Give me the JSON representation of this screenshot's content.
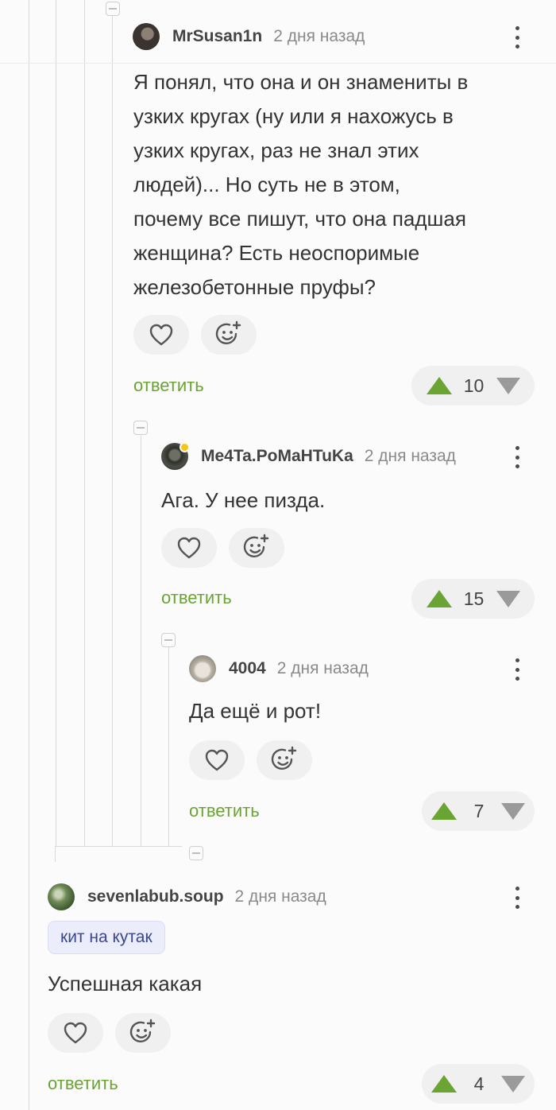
{
  "colors": {
    "accent_green": "#6aa432",
    "vote_down_gray": "#9a9a9a",
    "tag_bg": "#ecedfb",
    "tag_text": "#3b4690",
    "muted_text": "#8a8a8a"
  },
  "comments": [
    {
      "username": "MrSusan1n",
      "time": "2 дня назад",
      "lines": [
        "Я понял, что она и он знамениты в",
        "узких кругах (ну или я нахожусь в",
        "узких кругах, раз не знал этих",
        "людей)... Но суть не в этом,",
        "почему все пишут, что она падшая",
        "женщина? Есть неоспоримые",
        "железобетонные пруфы?"
      ],
      "reply_label": "ответить",
      "score": "10"
    },
    {
      "username": "Me4Ta.PoMaHTuKa",
      "time": "2 дня назад",
      "text": "Ага. У нее пизда.",
      "reply_label": "ответить",
      "score": "15"
    },
    {
      "username": "4004",
      "time": "2 дня назад",
      "text": "Да ещё и рот!",
      "reply_label": "ответить",
      "score": "7"
    },
    {
      "username": "sevenlabub.soup",
      "time": "2 дня назад",
      "tag": "кит на кутак",
      "text": "Успешная какая",
      "reply_label": "ответить",
      "score": "4"
    }
  ],
  "icons": {
    "like": "heart-icon",
    "react": "add-emoji-icon",
    "upvote": "upvote-arrow-icon",
    "downvote": "downvote-arrow-icon",
    "menu": "more-vertical-icon",
    "collapse": "collapse-thread-icon"
  }
}
